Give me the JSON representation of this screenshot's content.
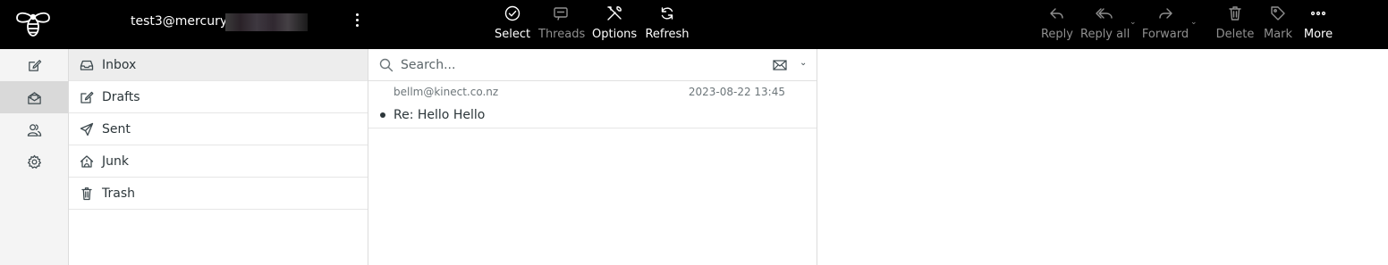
{
  "header": {
    "account": "test3@mercury.",
    "toolbar_center": [
      {
        "label": "Select",
        "icon": "select-circle-check-icon",
        "enabled": true
      },
      {
        "label": "Threads",
        "icon": "threads-icon",
        "enabled": false
      },
      {
        "label": "Options",
        "icon": "options-tools-icon",
        "enabled": true
      },
      {
        "label": "Refresh",
        "icon": "refresh-icon",
        "enabled": true
      }
    ],
    "toolbar_right": [
      {
        "label": "Reply",
        "icon": "reply-icon",
        "enabled": false
      },
      {
        "label": "Reply all",
        "icon": "reply-all-icon",
        "enabled": false
      },
      {
        "label": "Forward",
        "icon": "forward-icon",
        "enabled": false
      },
      {
        "label": "Delete",
        "icon": "trash-icon",
        "enabled": false
      },
      {
        "label": "Mark",
        "icon": "tag-icon",
        "enabled": false
      },
      {
        "label": "More",
        "icon": "more-dots-icon",
        "enabled": true
      }
    ]
  },
  "nav": {
    "items": [
      {
        "icon": "compose-icon",
        "active": false
      },
      {
        "icon": "mail-icon",
        "active": true
      },
      {
        "icon": "contacts-icon",
        "active": false
      },
      {
        "icon": "settings-gear-icon",
        "active": false
      }
    ]
  },
  "folders": [
    {
      "name": "Inbox",
      "icon": "inbox-icon",
      "active": true
    },
    {
      "name": "Drafts",
      "icon": "drafts-icon",
      "active": false
    },
    {
      "name": "Sent",
      "icon": "sent-icon",
      "active": false
    },
    {
      "name": "Junk",
      "icon": "junk-icon",
      "active": false
    },
    {
      "name": "Trash",
      "icon": "trash-icon",
      "active": false
    }
  ],
  "search": {
    "placeholder": "Search..."
  },
  "messages": [
    {
      "from": "bellm@kinect.co.nz",
      "date": "2023-08-22 13:45",
      "subject": "Re: Hello Hello",
      "unread": true
    }
  ],
  "colors": {
    "topbar": "#000000",
    "disabled_text": "#8f8f8f",
    "active_row": "#ededed"
  }
}
